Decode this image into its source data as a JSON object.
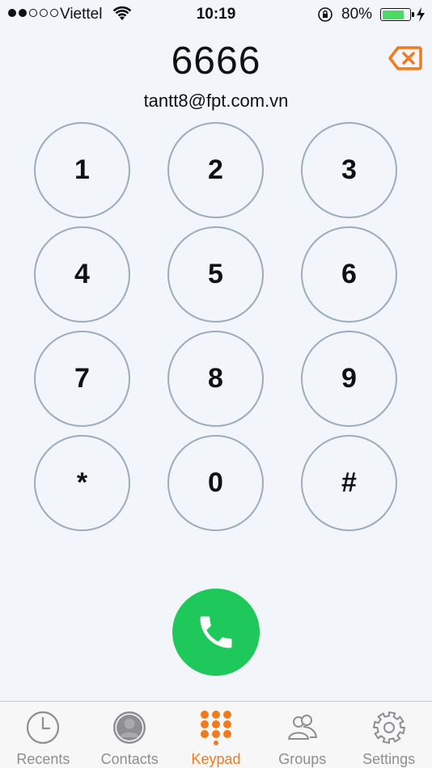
{
  "status_bar": {
    "carrier": "Viettel",
    "time": "10:19",
    "battery_percent": "80%",
    "battery_level": 0.8,
    "signal_bars_filled": 2,
    "signal_bars_total": 5
  },
  "dialer": {
    "number": "6666",
    "contact_email": "tantt8@fpt.com.vn"
  },
  "keypad": {
    "keys": [
      "1",
      "2",
      "3",
      "4",
      "5",
      "6",
      "7",
      "8",
      "9",
      "*",
      "0",
      "#"
    ]
  },
  "colors": {
    "accent": "#f07b1d",
    "call_green": "#1fc85a",
    "key_border": "#9aacbd",
    "background": "#f2f5f9"
  },
  "tabs": [
    {
      "label": "Recents",
      "icon": "clock-icon",
      "active": false
    },
    {
      "label": "Contacts",
      "icon": "person-icon",
      "active": false
    },
    {
      "label": "Keypad",
      "icon": "keypad-grid-icon",
      "active": true
    },
    {
      "label": "Groups",
      "icon": "group-icon",
      "active": false
    },
    {
      "label": "Settings",
      "icon": "gear-icon",
      "active": false
    }
  ]
}
